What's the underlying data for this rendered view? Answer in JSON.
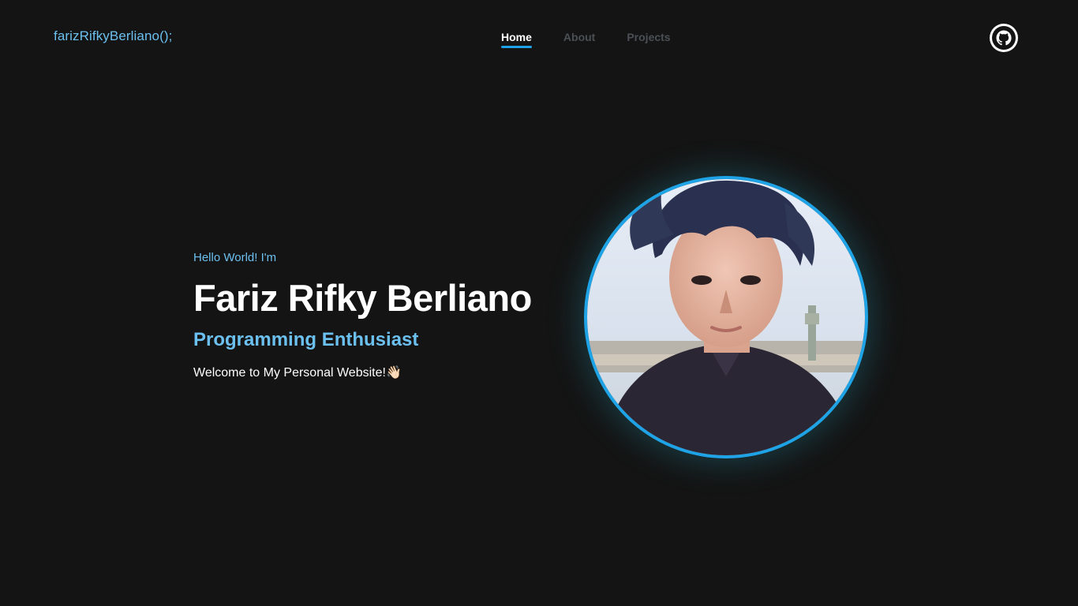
{
  "nav": {
    "brand": "farizRifkyBerliano();",
    "links": [
      {
        "label": "Home",
        "active": true
      },
      {
        "label": "About",
        "active": false
      },
      {
        "label": "Projects",
        "active": false
      }
    ],
    "github_icon": "github-icon"
  },
  "hero": {
    "greeting": "Hello World! I'm",
    "name": "Fariz Rifky Berliano",
    "role": "Programming Enthusiast",
    "welcome": "Welcome to My Personal Website!",
    "welcome_emoji": "👋🏻"
  },
  "colors": {
    "background": "#141414",
    "accent": "#6cc0ef",
    "ring": "#1ea4e6",
    "text": "#ffffff",
    "muted": "#4b4f55"
  }
}
